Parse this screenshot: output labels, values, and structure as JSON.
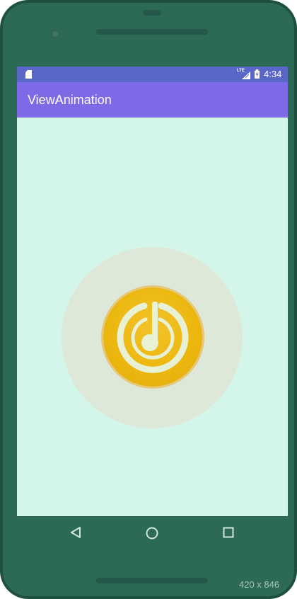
{
  "status_bar": {
    "network_label": "LTE",
    "time": "4:34",
    "icons": [
      "sd-card-icon",
      "signal-icon",
      "battery-icon"
    ]
  },
  "app_bar": {
    "title": "ViewAnimation"
  },
  "main": {
    "center_button_icon": "music-power-icon"
  },
  "nav_bar": {
    "icons": [
      "back-icon",
      "home-icon",
      "recent-apps-icon"
    ]
  },
  "overlay": {
    "resolution_label": "420 x 846"
  },
  "colors": {
    "status_bar": "#5a67c8",
    "app_bar": "#7c6ae6",
    "screen_background": "#d4f6ea",
    "outer_ring": "#dde8d9",
    "button": "#ecb70f",
    "icon": "#e8f1d4",
    "device_frame": "#2d6a55"
  }
}
